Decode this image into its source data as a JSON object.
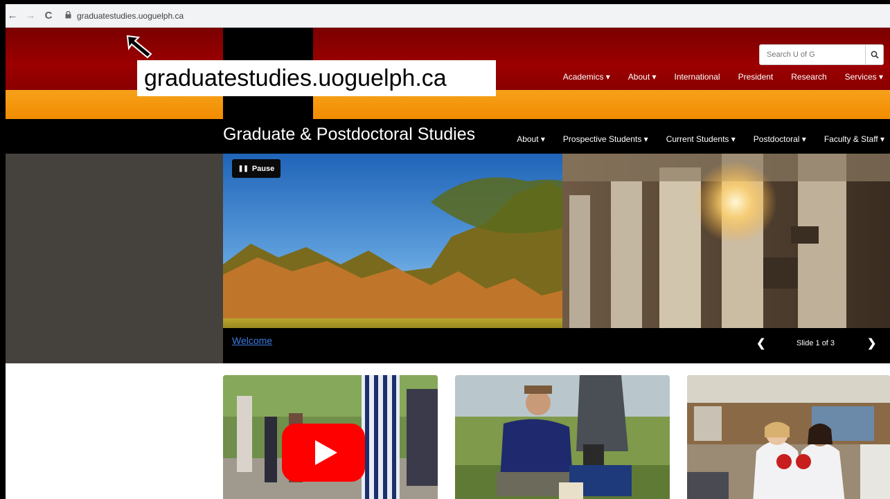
{
  "browser": {
    "back_glyph": "←",
    "forward_glyph": "→",
    "reload_glyph": "C",
    "lock_glyph": "🔒",
    "url": "graduatestudies.uoguelph.ca"
  },
  "annotation": {
    "callout_text": "graduatestudies.uoguelph.ca"
  },
  "header": {
    "search_placeholder": "Search U of G",
    "search_icon": "magnifier-icon",
    "nav": [
      {
        "label": "Academics ▾"
      },
      {
        "label": "About ▾"
      },
      {
        "label": "International"
      },
      {
        "label": "President"
      },
      {
        "label": "Research"
      },
      {
        "label": "Services ▾"
      }
    ]
  },
  "site": {
    "title": "Graduate & Postdoctoral Studies",
    "nav": [
      {
        "label": "About ▾"
      },
      {
        "label": "Prospective Students ▾"
      },
      {
        "label": "Current Students ▾"
      },
      {
        "label": "Postdoctoral ▾"
      },
      {
        "label": "Faculty & Staff ▾"
      }
    ]
  },
  "hero": {
    "pause_label": "Pause",
    "pause_icon": "❚❚",
    "caption_link": "Welcome",
    "slide_counter": "Slide 1 of 3",
    "prev_icon": "❮",
    "next_icon": "❯"
  },
  "colors": {
    "header_red": "#8b0000",
    "header_orange": "#f28c00",
    "link_blue": "#3b7ae0"
  }
}
